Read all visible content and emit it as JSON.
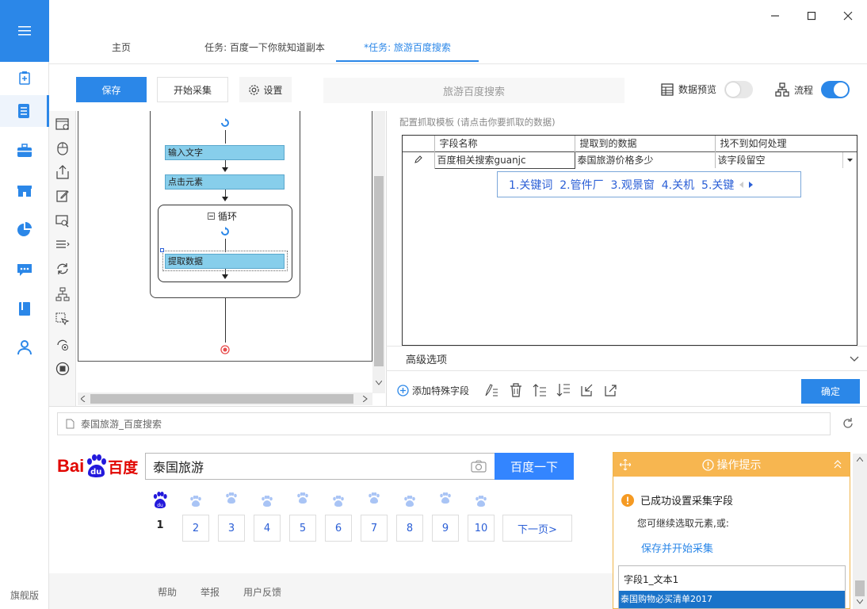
{
  "sidebar": {
    "edition": "旗舰版",
    "menu_icon": "hamburger-icon",
    "items": [
      "clipboard-plus-icon",
      "document-icon",
      "briefcase-icon",
      "store-icon",
      "pie-chart-icon",
      "message-icon",
      "book-icon",
      "user-icon"
    ]
  },
  "tabs": [
    {
      "label": "主页"
    },
    {
      "label": "任务: 百度一下你就知道副本"
    },
    {
      "label": "*任务: 旅游百度搜索"
    }
  ],
  "toolbar": {
    "save": "保存",
    "start": "开始采集",
    "settings": "设置",
    "task_name": "旅游百度搜索",
    "data_preview": "数据预览",
    "flow": "流程"
  },
  "flow": {
    "nodes": {
      "input": "输入文字",
      "click": "点击元素",
      "loop": "循环",
      "extract": "提取数据"
    }
  },
  "right": {
    "template_hint": "配置抓取模板 (请点击你要抓取的数据)",
    "columns": [
      "字段名称",
      "提取到的数据",
      "找不到如何处理"
    ],
    "row": {
      "field": "百度相关搜索guanjc",
      "value": "泰国旅游价格多少",
      "fallback": "该字段留空"
    },
    "ime": "1.关键词  2.管件厂  3.观景窗  4.关机  5.关键",
    "advanced": "高级选项",
    "add_special": "添加特殊字段",
    "confirm": "确定"
  },
  "browser": {
    "address": "泰国旅游_百度搜索",
    "logo_left": "Bai",
    "logo_badge": "du",
    "logo_right": "百度",
    "search_value": "泰国旅游",
    "search_btn": "百度一下",
    "current_page": "1",
    "pages": [
      "2",
      "3",
      "4",
      "5",
      "6",
      "7",
      "8",
      "9",
      "10"
    ],
    "next": "下一页>",
    "footer": [
      "帮助",
      "举报",
      "用户反馈"
    ]
  },
  "hint": {
    "title": "操作提示",
    "success": "已成功设置采集字段",
    "sub": "您可继续选取元素,或:",
    "action": "保存并开始采集",
    "field": "字段1_文本1",
    "selected": "泰国购物必买清单2017"
  },
  "colors": {
    "accent": "#2b87e8",
    "hint_header": "#f7b650"
  }
}
